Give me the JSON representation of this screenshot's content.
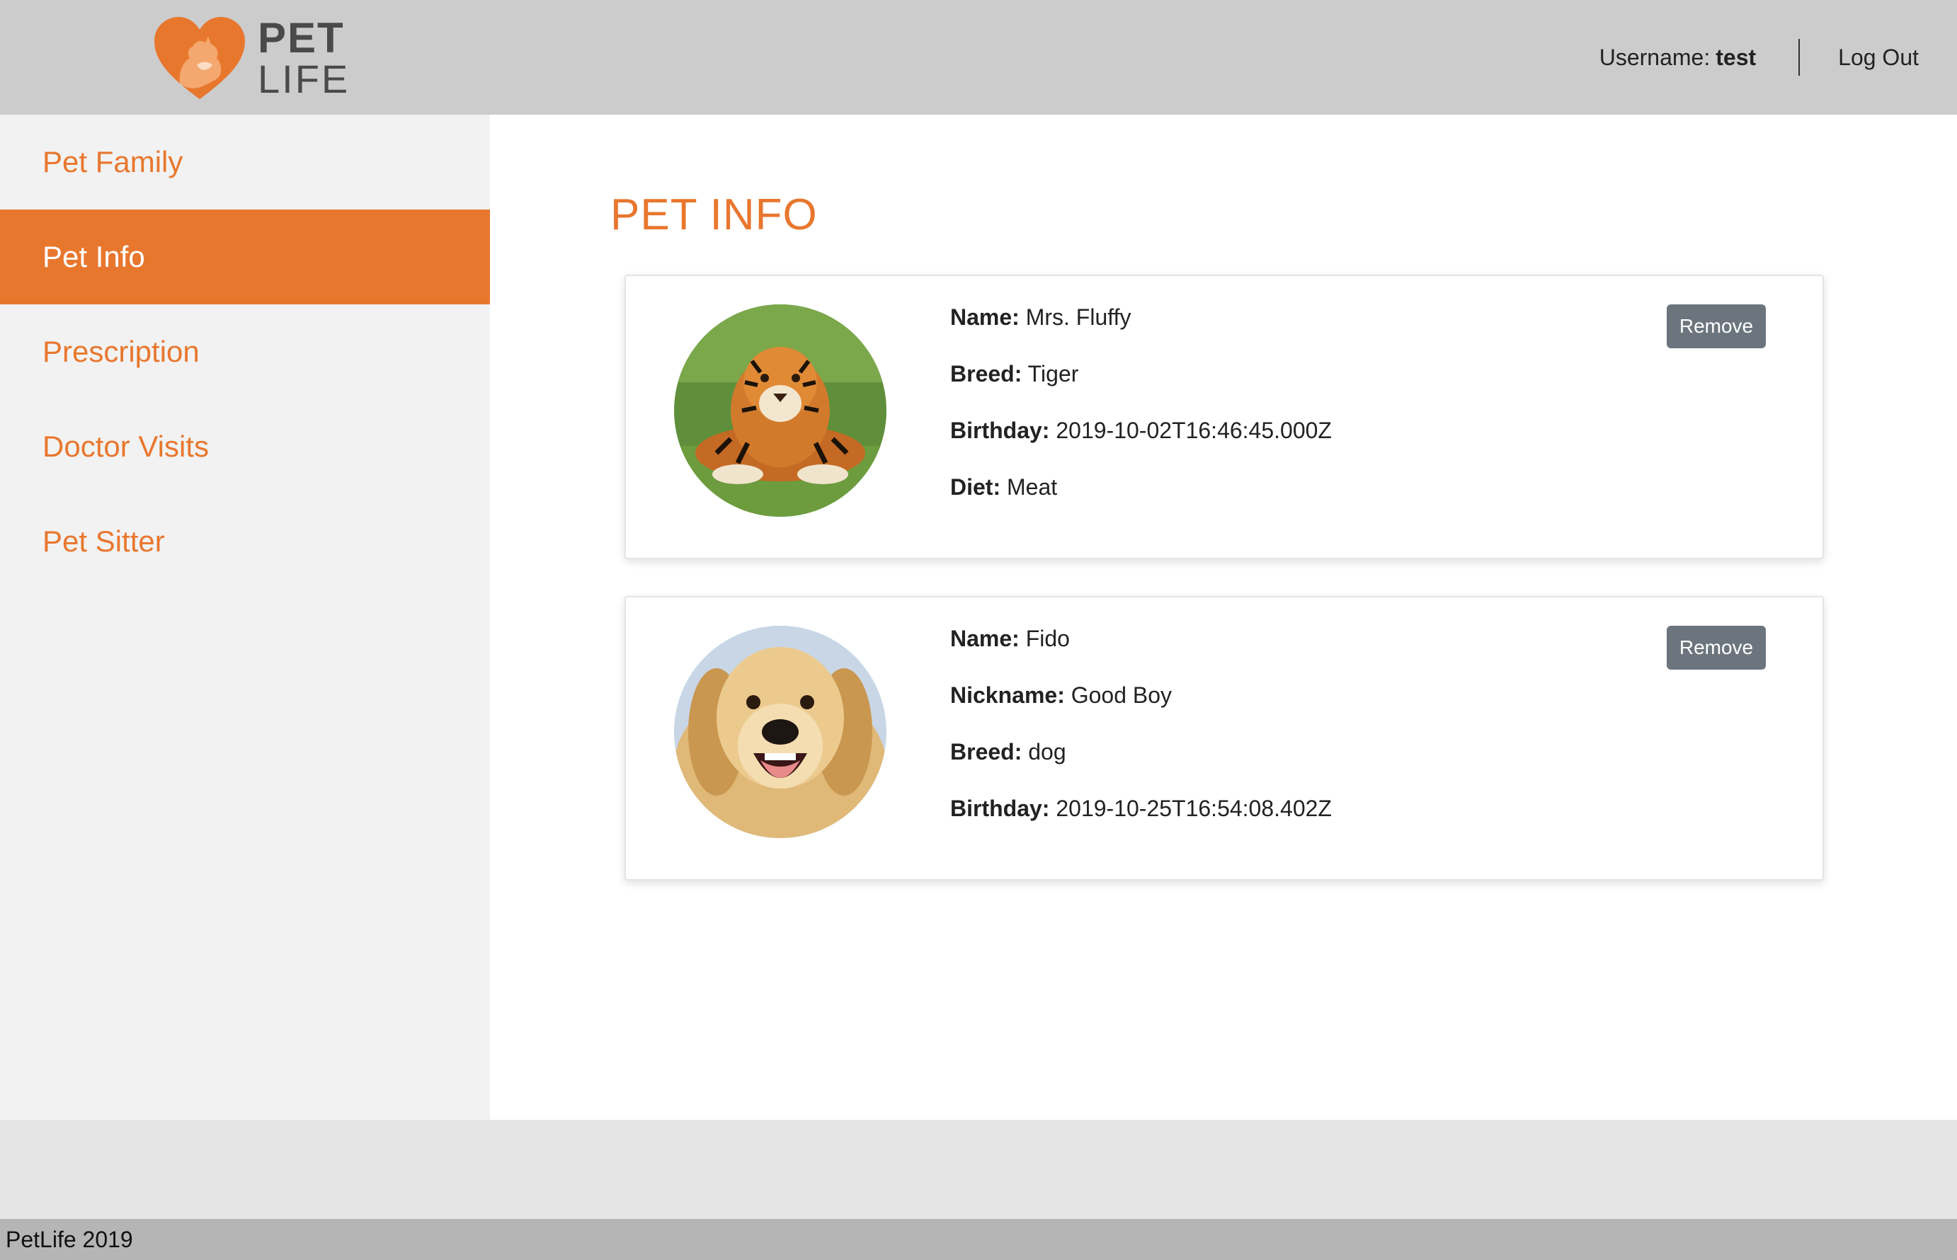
{
  "brand": {
    "line1": "PET",
    "line2": "LIFE",
    "accent_color": "#e8772e"
  },
  "header": {
    "username_label": "Username:",
    "username_value": "test",
    "logout_label": "Log Out"
  },
  "sidebar": {
    "items": [
      {
        "label": "Pet Family",
        "active": false
      },
      {
        "label": "Pet Info",
        "active": true
      },
      {
        "label": "Prescription",
        "active": false
      },
      {
        "label": "Doctor Visits",
        "active": false
      },
      {
        "label": "Pet Sitter",
        "active": false
      }
    ]
  },
  "main": {
    "title": "PET INFO",
    "pets": [
      {
        "photo_icon": "tiger-photo",
        "remove_label": "Remove",
        "fields": [
          {
            "label": "Name:",
            "value": "Mrs. Fluffy"
          },
          {
            "label": "Breed:",
            "value": "Tiger"
          },
          {
            "label": "Birthday:",
            "value": "2019-10-02T16:46:45.000Z"
          },
          {
            "label": "Diet:",
            "value": "Meat"
          }
        ]
      },
      {
        "photo_icon": "dog-photo",
        "remove_label": "Remove",
        "fields": [
          {
            "label": "Name:",
            "value": "Fido"
          },
          {
            "label": "Nickname:",
            "value": "Good Boy"
          },
          {
            "label": "Breed:",
            "value": "dog"
          },
          {
            "label": "Birthday:",
            "value": "2019-10-25T16:54:08.402Z"
          }
        ]
      }
    ]
  },
  "footer": {
    "text": "PetLife 2019"
  }
}
